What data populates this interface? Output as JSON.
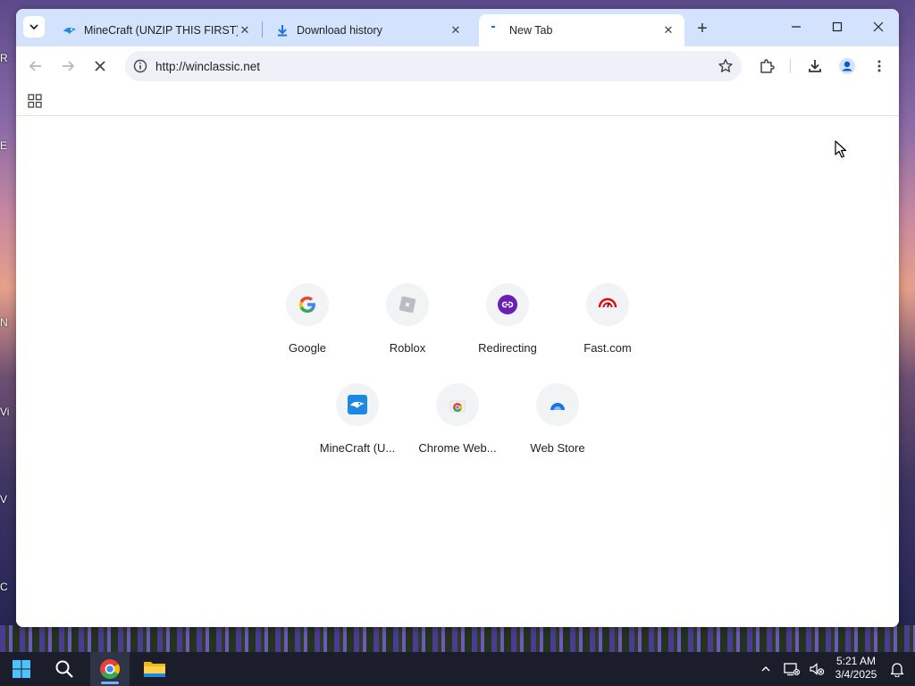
{
  "browser": {
    "tabs": [
      {
        "title": "MineCraft (UNZIP THIS FIRST)",
        "active": false
      },
      {
        "title": "Download history",
        "active": false
      },
      {
        "title": "New Tab",
        "active": true
      }
    ],
    "url": "http://winclassic.net"
  },
  "shortcuts": [
    {
      "label": "Google",
      "icon": "google-icon"
    },
    {
      "label": "Roblox",
      "icon": "roblox-icon"
    },
    {
      "label": "Redirecting",
      "icon": "redirect-link-icon"
    },
    {
      "label": "Fast.com",
      "icon": "speed-gauge-icon"
    },
    {
      "label": "MineCraft (U...",
      "icon": "minecraft-bird-icon"
    },
    {
      "label": "Chrome Web...",
      "icon": "chrome-web-store-icon"
    },
    {
      "label": "Web Store",
      "icon": "web-store-icon"
    }
  ],
  "desktop_icon_fragments": [
    "R",
    "E",
    "N",
    "Vi",
    "V",
    "C"
  ],
  "taskbar": {
    "time": "5:21 AM",
    "date": "3/4/2025"
  },
  "colors": {
    "tabstrip": "#d3e3fd",
    "omnibox": "#eef1f7",
    "tile_bg": "#f1f3f4",
    "taskbar": "#1b1d2b"
  }
}
